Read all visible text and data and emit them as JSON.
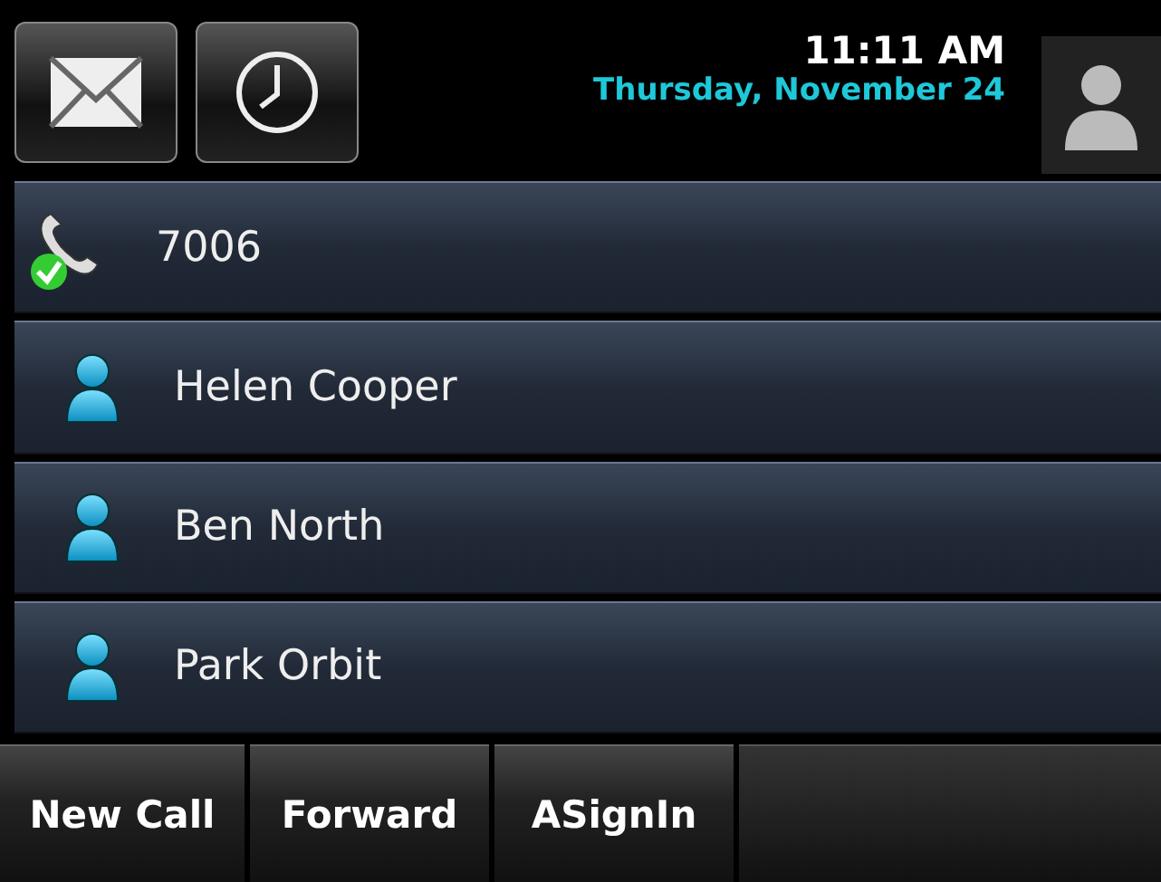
{
  "status_bar": {
    "time": "11:11 AM",
    "date": "Thursday, November 24"
  },
  "lines": [
    {
      "kind": "line",
      "label": "7006",
      "registered": true
    },
    {
      "kind": "contact",
      "label": "Helen Cooper"
    },
    {
      "kind": "contact",
      "label": "Ben North"
    },
    {
      "kind": "contact",
      "label": "Park Orbit"
    }
  ],
  "softkeys": [
    "New Call",
    "Forward",
    "ASignIn"
  ]
}
